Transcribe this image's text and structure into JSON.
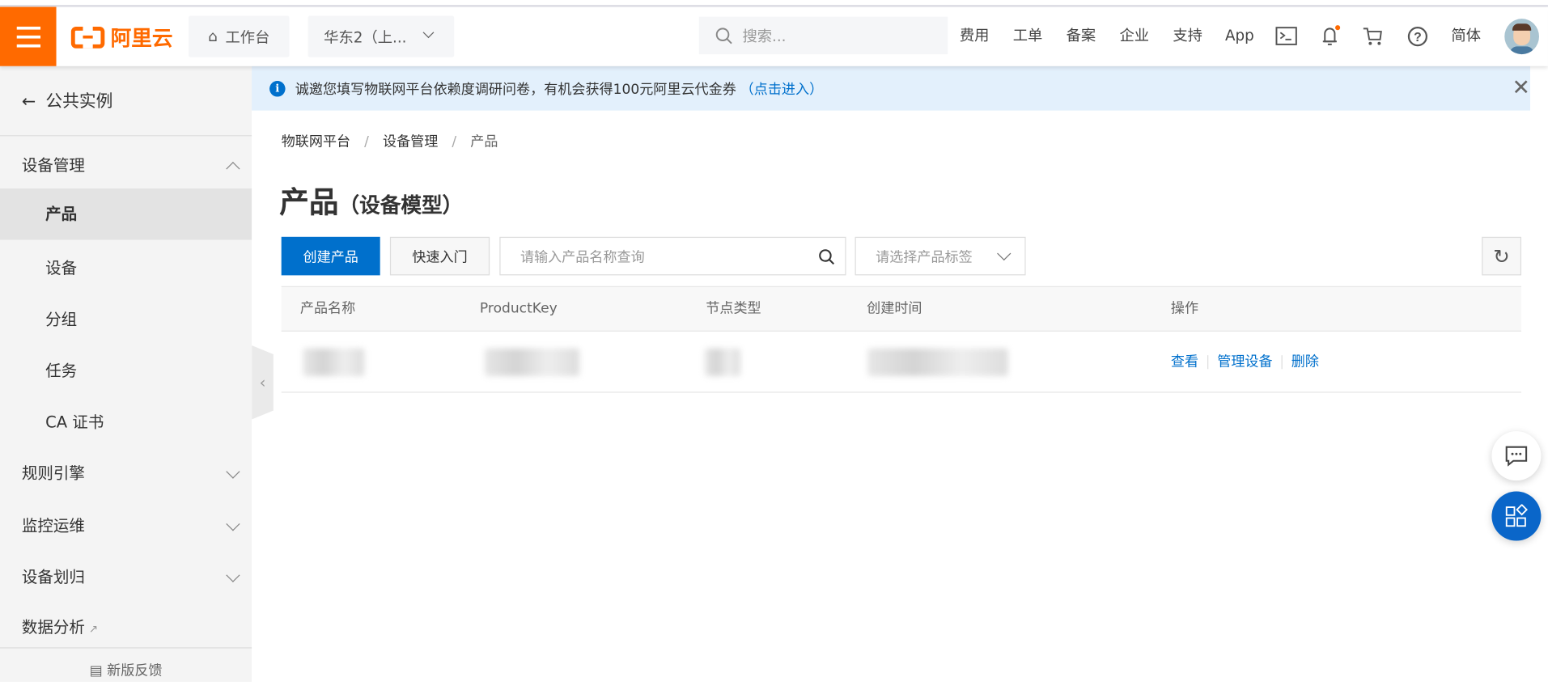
{
  "header": {
    "logo_text": "阿里云",
    "workbench_label": "工作台",
    "region_label": "华东2（上...",
    "search_placeholder": "搜索...",
    "nav_links": [
      "费用",
      "工单",
      "备案",
      "企业",
      "支持",
      "App"
    ],
    "language_label": "简体",
    "brand_color": "#ff6a00",
    "icons": [
      "menu-icon",
      "home-icon",
      "search-icon",
      "terminal-icon",
      "bell-icon",
      "cart-icon",
      "help-icon"
    ]
  },
  "sidebar": {
    "back_label": "公共实例",
    "groups": [
      {
        "label": "设备管理",
        "expanded": true,
        "items": [
          "产品",
          "设备",
          "分组",
          "任务",
          "CA 证书"
        ],
        "active": "产品"
      },
      {
        "label": "规则引擎",
        "expanded": false
      },
      {
        "label": "监控运维",
        "expanded": false
      },
      {
        "label": "设备划归",
        "expanded": false
      },
      {
        "label": "数据分析",
        "external": true
      }
    ],
    "feedback_label": "新版反馈"
  },
  "banner": {
    "text": "诚邀您填写物联网平台依赖度调研问卷，有机会获得100元阿里云代金券",
    "link": "（点击进入）"
  },
  "breadcrumb": [
    "物联网平台",
    "设备管理",
    "产品"
  ],
  "page": {
    "title": "产品",
    "subtitle": "（设备模型）"
  },
  "toolbar": {
    "create_label": "创建产品",
    "quickstart_label": "快速入门",
    "search_placeholder": "请输入产品名称查询",
    "tag_select_placeholder": "请选择产品标签",
    "accent_color": "#0070cc"
  },
  "table": {
    "columns": [
      "产品名称",
      "ProductKey",
      "节点类型",
      "创建时间",
      "操作"
    ],
    "rows": [
      {
        "actions": [
          "查看",
          "管理设备",
          "删除"
        ]
      }
    ]
  }
}
